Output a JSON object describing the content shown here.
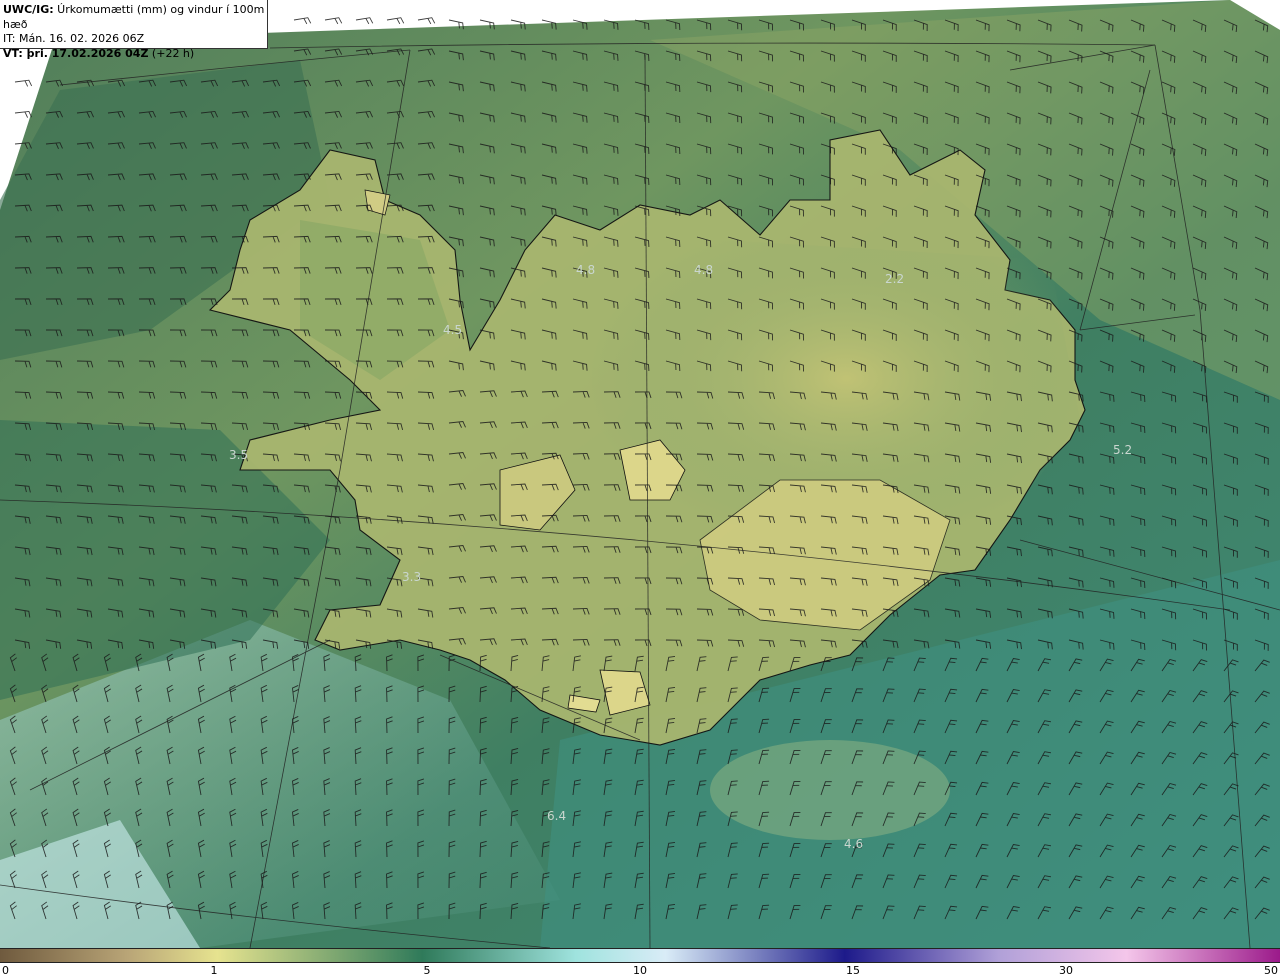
{
  "header": {
    "line1_bold": "UWC/IG:",
    "line1_rest": " Úrkomumætti (mm) og vindur í 100m hæð",
    "line2": "IT: Mán. 16. 02. 2026 06Z",
    "line3_bold": "VT: þri. 17.02.2026 04Z",
    "line3_rest": " (+22 h)"
  },
  "map": {
    "value_labels": [
      {
        "id": "v1",
        "text": "4.8"
      },
      {
        "id": "v2",
        "text": "4.8"
      },
      {
        "id": "v3",
        "text": "2.2"
      },
      {
        "id": "v4",
        "text": "4.5"
      },
      {
        "id": "v5",
        "text": "3.5"
      },
      {
        "id": "v6",
        "text": "5.2"
      },
      {
        "id": "v7",
        "text": "3.3"
      },
      {
        "id": "v8",
        "text": "6.4"
      },
      {
        "id": "v9",
        "text": "4.6"
      }
    ]
  },
  "colorbar": {
    "tick_labels": [
      "0",
      "1",
      "5",
      "10",
      "15",
      "30",
      "50"
    ],
    "colors": [
      "#6f5a3e",
      "#b9a577",
      "#e6e38f",
      "#2f7a5a",
      "#9fe3de",
      "#d9ecf7",
      "#1d1a8a",
      "#b0a0d8",
      "#f4c6ea",
      "#9b1a8a"
    ]
  }
}
